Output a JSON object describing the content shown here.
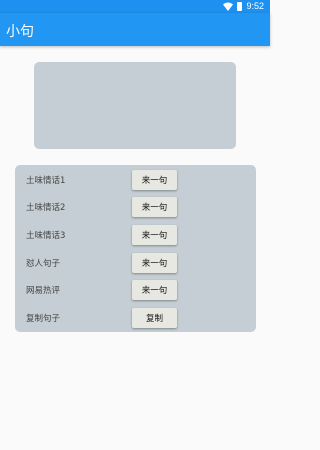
{
  "status_bar": {
    "time": "9:52",
    "icons": [
      "wifi-icon",
      "battery-icon"
    ],
    "background": "#1e90f0"
  },
  "app_bar": {
    "title": "小句",
    "background": "#2196f3"
  },
  "display_panel": {
    "text": "",
    "background": "#c5ced4"
  },
  "menu": {
    "background": "#c5ced4",
    "rows": [
      {
        "label": "土味情话1",
        "button": "来一句"
      },
      {
        "label": "土味情话2",
        "button": "来一句"
      },
      {
        "label": "土味情话3",
        "button": "来一句"
      },
      {
        "label": "怼人句子",
        "button": "来一句"
      },
      {
        "label": "网易热评",
        "button": "来一句"
      },
      {
        "label": "复制句子",
        "button": "复制"
      }
    ]
  }
}
